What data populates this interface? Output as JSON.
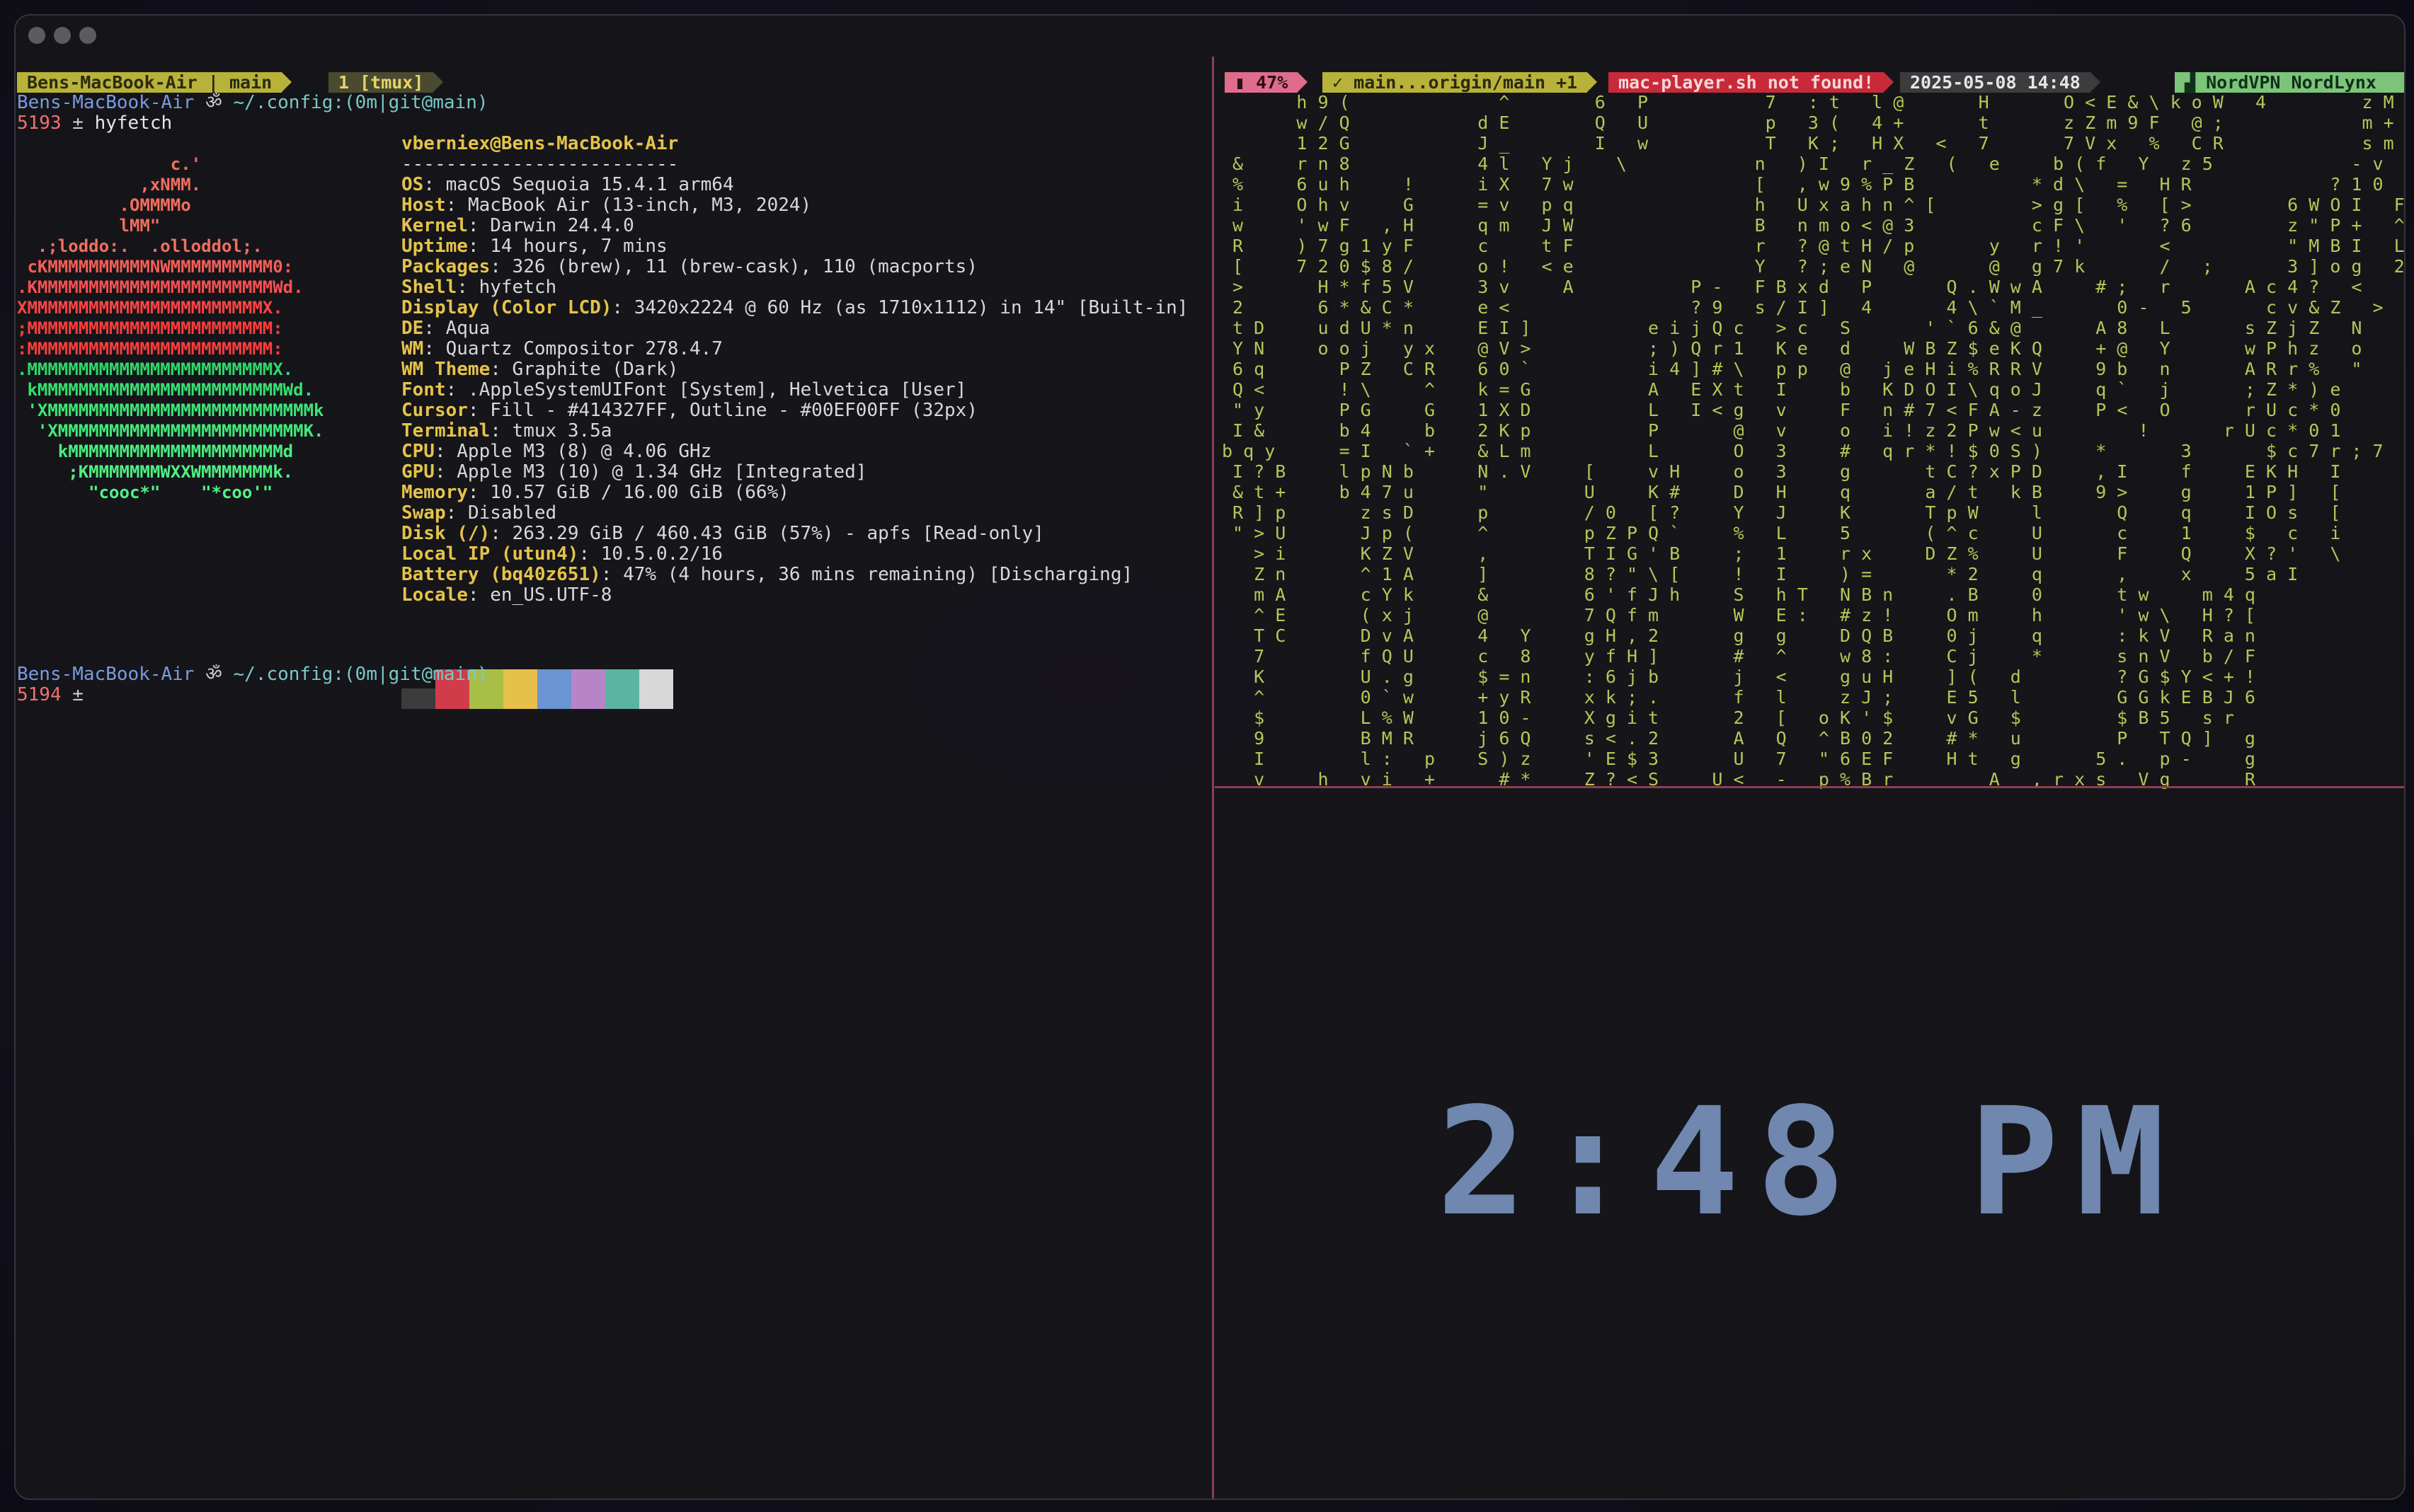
{
  "left_status": {
    "session": "Bens-MacBook-Air | main",
    "window": "1 [tmux]"
  },
  "right_status": {
    "battery": "47%",
    "git": "main...origin/main +1",
    "player": "mac-player.sh not found!",
    "datetime": "2025-05-08 14:48",
    "vpn": "NordVPN NordLynx"
  },
  "prompt1": {
    "host": "Bens-MacBook-Air",
    "path": "~/.config:(0m|git@main)",
    "line_no": "5193",
    "command": "hyfetch"
  },
  "prompt2": {
    "host": "Bens-MacBook-Air",
    "path": "~/.config:(0m|git@main)",
    "line_no": "5194"
  },
  "fetch": {
    "user_host": "vberniex@Bens-MacBook-Air",
    "separator": "-------------------------",
    "rows": [
      {
        "key": "OS",
        "value": "macOS Sequoia 15.4.1 arm64"
      },
      {
        "key": "Host",
        "value": "MacBook Air (13-inch, M3, 2024)"
      },
      {
        "key": "Kernel",
        "value": "Darwin 24.4.0"
      },
      {
        "key": "Uptime",
        "value": "14 hours, 7 mins"
      },
      {
        "key": "Packages",
        "value": "326 (brew), 11 (brew-cask), 110 (macports)"
      },
      {
        "key": "Shell",
        "value": "hyfetch"
      },
      {
        "key": "Display (Color LCD)",
        "value": "3420x2224 @ 60 Hz (as 1710x1112) in 14\" [Built-in]"
      },
      {
        "key": "DE",
        "value": "Aqua"
      },
      {
        "key": "WM",
        "value": "Quartz Compositor 278.4.7"
      },
      {
        "key": "WM Theme",
        "value": "Graphite (Dark)"
      },
      {
        "key": "Font",
        "value": ".AppleSystemUIFont [System], Helvetica [User]"
      },
      {
        "key": "Cursor",
        "value": "Fill - #414327FF, Outline - #00EF00FF (32px)"
      },
      {
        "key": "Terminal",
        "value": "tmux 3.5a"
      },
      {
        "key": "CPU",
        "value": "Apple M3 (8) @ 4.06 GHz"
      },
      {
        "key": "GPU",
        "value": "Apple M3 (10) @ 1.34 GHz [Integrated]"
      },
      {
        "key": "Memory",
        "value": "10.57 GiB / 16.00 GiB (66%)"
      },
      {
        "key": "Swap",
        "value": "Disabled"
      },
      {
        "key": "Disk (/)",
        "value": "263.29 GiB / 460.43 GiB (57%) - apfs [Read-only]"
      },
      {
        "key": "Local IP (utun4)",
        "value": "10.5.0.2/16"
      },
      {
        "key": "Battery (bq40z651)",
        "value": "47% (4 hours, 36 mins remaining) [Discharging]"
      },
      {
        "key": "Locale",
        "value": "en_US.UTF-8"
      }
    ],
    "palette": [
      "#3c3c3c",
      "#d03c4a",
      "#a8be46",
      "#e7c04a",
      "#6b94d2",
      "#b884c8",
      "#5ab4a0",
      "#d8d8d8"
    ]
  },
  "logo": [
    {
      "text": "               c.'",
      "color": "#f26e5e"
    },
    {
      "text": "            ,xNMM.",
      "color": "#f26e5e"
    },
    {
      "text": "          .OMMMMo",
      "color": "#f26e5e"
    },
    {
      "text": "          lMM\"",
      "color": "#f26e5e"
    },
    {
      "text": "  .;loddo:.  .olloddol;.",
      "color": "#f26e5e"
    },
    {
      "text": " cKMMMMMMMMMMNWMMMMMMMMMM0:",
      "color": "#f65e58"
    },
    {
      "text": ".KMMMMMMMMMMMMMMMMMMMMMMMWd.",
      "color": "#fa5050"
    },
    {
      "text": "XMMMMMMMMMMMMMMMMMMMMMMMX.",
      "color": "#ff4444"
    },
    {
      "text": ";MMMMMMMMMMMMMMMMMMMMMMMM:",
      "color": "#ff3c3c"
    },
    {
      "text": ":MMMMMMMMMMMMMMMMMMMMMMMM:",
      "color": "#ff3c3c"
    },
    {
      "text": ".MMMMMMMMMMMMMMMMMMMMMMMMX.",
      "color": "#2fd86a"
    },
    {
      "text": " kMMMMMMMMMMMMMMMMMMMMMMMMWd.",
      "color": "#36e070"
    },
    {
      "text": " 'XMMMMMMMMMMMMMMMMMMMMMMMMMMk",
      "color": "#3ce676"
    },
    {
      "text": "  'XMMMMMMMMMMMMMMMMMMMMMMMMK.",
      "color": "#42ea7a"
    },
    {
      "text": "    kMMMMMMMMMMMMMMMMMMMMMd",
      "color": "#48ee7e"
    },
    {
      "text": "     ;KMMMMMMMWXXWMMMMMMMk.",
      "color": "#4ef082"
    },
    {
      "text": "       \"cooc*\"    \"*coo'\"",
      "color": "#52f286"
    }
  ],
  "matrix_rows": [
    "       h 9 (              ^        6   P           7   : t   l @       H       O < E & \\ k o W   4         z M   l",
    "       w / Q            d E        Q   U           p   3 (   4 +       t       z Z m 9 F   @ ;             m +   I",
    "       1 2 G            J _        I   w           T   K ;   H X   <   7       7 V x   %   C R             s m   (",
    " &     r n 8            4 l   Y j    \\            n   ) I   r _ Z   (   e     b ( f   Y   z 5             - v   &",
    " %     6 u h     !      i X   7 w                 [   , w 9 % P B           * d \\   =   H R             ? 1 0   Y",
    " i     O h v     G      = v   p q                 h   U x a h n ^ [         > g [   %   [ >         6 W O I   F",
    " w     ' w F   , H      q m   J W                 B   n m o < @ 3           c F \\   '   ? 6         z \" P +   ^",
    " R     ) 7 g 1 y F      c     t F                 r   ? @ t H / p       y   r ! '       <           \" M B I   L",
    " [     7 2 0 $ 8 /      o !   < e                 Y   ? ; e N   @       @   g 7 k       /   ;       3 ] o g   2",
    " >       H * f 5 V      3 v     A           P -   F B x d   P       Q . W w A     # ;   r       A c 4 ?   <",
    " 2       6 * & C *      e <                 ? 9   s / I ]   4       4 \\ ` M _       0 -   5       c v & Z   >",
    " t D     u d U * n      E I ]           e i j Q c   > c   S       ' ` 6 & @       A 8   L       s Z j Z   N",
    " Y N     o o j   y x    @ V >           ; ) Q r 1   K e   d     W B Z $ e K Q     + @   Y       w P h z   o",
    " 6 q       P Z   C R    6 0 `           i 4 ] # \\   p p   @   j e H i % R R V     9 b   n       A R r %   \"",
    " Q <       ! \\     ^    k = G           A   E X t   I     b   K D O I \\ q o J     q `   j       ; Z * ) e",
    " \" y       P G     G    1 X D           L   I < g   v     F   n # 7 < F A - z     P <   O       r U c * 0",
    " I &       b 4     b    2 K p           P       @   v     o   i ! z 2 P w < u         !       r U c * 0 1",
    "b q y      = I   ` +    & L m           L       O   3     #   q r * ! $ 0 S )     *       3       $ c 7 r ; 7",
    " I ? B     l p N b      N . V     [     v H     o   3     g       t C ? x P D     , I     f     E K H   I",
    " & t +     b 4 7 u      \"         U     K #     D   H     q       a / t   k B     9 >     g     1 P ]   [",
    " R ] p       z s D      p         / 0   [ ?     Y   J     K       T p W     l       Q     q     I O s   [",
    " \" > U       J p (      ^         p Z P Q `     %   L     5       ( ^ c     U       c     1     $   c   i",
    "   > i       K Z V      ,         T I G ' B     ;   1     r x     D Z %     U       F     Q     X ? '   \\",
    "   Z n       ^ 1 A      ]         8 ? \" \\ [     !   I     ) =       * 2     q       ,     x     5 a I",
    "   m A       c Y k      &         6 ' f J h     S   h T   N B n     . B     0       t w     m 4 q",
    "   ^ E       ( x j      @         7 Q f m       W   E :   # z !     O m     h       ' w \\   H ? [",
    "   T C       D v A      4   Y     g H , 2       g   g     D Q B     0 j     q       : k V   R a n",
    "   7         f Q U      c   8     y f H ]       #   ^     w 8 :     C j     *       s n V   b / F",
    "   K         U . g      $ = n     : 6 j b       j   <     g u H     ] (   d         ? G $ Y < + !",
    "   ^         0 ` w      + y R     x k ; .       f   l     z J ;     E 5   l         G G k E B J 6",
    "   $         L % W      1 0 -     X g i t       2   [   o K ' $     v G   $         $ B 5   s r",
    "   9         B M R      j 6 Q     s < . 2       A   Q   ^ B 0 2     # *   u         P   T Q ]   g",
    "   I         l :   p    S ) z     ' E $ 3       U   7   \" 6 E F     H t   g       5 .   p -     g",
    "   v     h   v i   +      # *     Z ? < S     U <   -   p % B r         A   , r x s   V g       R"
  ],
  "clock": "2:48 PM"
}
